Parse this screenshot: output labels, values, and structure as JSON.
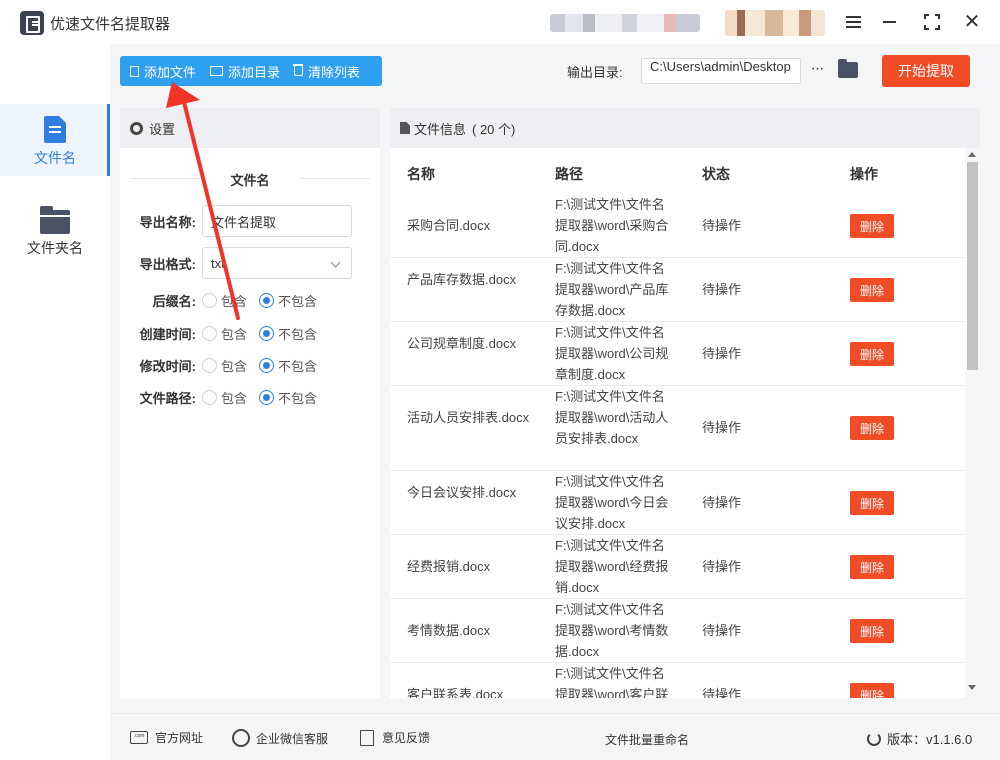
{
  "app": {
    "title": "优速文件名提取器"
  },
  "sidebar": {
    "items": [
      {
        "label": "文件名",
        "icon": "file-icon",
        "active": true
      },
      {
        "label": "文件夹名",
        "icon": "folder-icon",
        "active": false
      }
    ]
  },
  "toolbar": {
    "add_file": "添加文件",
    "add_dir": "添加目录",
    "clear_list": "清除列表",
    "output_label": "输出目录:",
    "output_value": "C:\\Users\\admin\\Desktop",
    "more": "···",
    "start": "开始提取",
    "accent_color": "#2f9ff0",
    "start_color": "#f04c26"
  },
  "settings": {
    "header": "设置",
    "subtitle": "文件名",
    "export_name_label": "导出名称:",
    "export_name_value": "文件名提取",
    "export_format_label": "导出格式:",
    "export_format_value": "txt",
    "options": [
      {
        "label": "后缀名:",
        "opt_a": "包含",
        "opt_b": "不包含",
        "selected": "不包含"
      },
      {
        "label": "创建时间:",
        "opt_a": "包含",
        "opt_b": "不包含",
        "selected": "不包含"
      },
      {
        "label": "修改时间:",
        "opt_a": "包含",
        "opt_b": "不包含",
        "selected": "不包含"
      },
      {
        "label": "文件路径:",
        "opt_a": "包含",
        "opt_b": "不包含",
        "selected": "不包含"
      }
    ]
  },
  "files": {
    "header": "文件信息",
    "count": "( 20 个)",
    "columns": [
      "名称",
      "路径",
      "状态",
      "操作"
    ],
    "delete_label": "删除",
    "rows": [
      {
        "name": "采购合同.docx",
        "path": "F:\\测试文件\\文件名提取器\\word\\采购合同.docx",
        "status": "待操作"
      },
      {
        "name": "产品库存数据.docx",
        "path": "F:\\测试文件\\文件名提取器\\word\\产品库存数据.docx",
        "status": "待操作"
      },
      {
        "name": "公司规章制度.docx",
        "path": "F:\\测试文件\\文件名提取器\\word\\公司规章制度.docx",
        "status": "待操作"
      },
      {
        "name": "活动人员安排表.docx",
        "path": "F:\\测试文件\\文件名提取器\\word\\活动人员安排表.docx",
        "status": "待操作"
      },
      {
        "name": "今日会议安排.docx",
        "path": "F:\\测试文件\\文件名提取器\\word\\今日会议安排.docx",
        "status": "待操作"
      },
      {
        "name": "经费报销.docx",
        "path": "F:\\测试文件\\文件名提取器\\word\\经费报销.docx",
        "status": "待操作"
      },
      {
        "name": "考情数据.docx",
        "path": "F:\\测试文件\\文件名提取器\\word\\考情数据.docx",
        "status": "待操作"
      },
      {
        "name": "客户联系表.docx",
        "path": "F:\\测试文件\\文件名提取器\\word\\客户联系表.docx",
        "status": "待操作"
      }
    ]
  },
  "footer": {
    "website": "官方网址",
    "wechat": "企业微信客服",
    "feedback": "意见反馈",
    "center": "文件批量重命名",
    "version_label": "版本：v1.1.6.0",
    "com_icon_text": ".com"
  }
}
